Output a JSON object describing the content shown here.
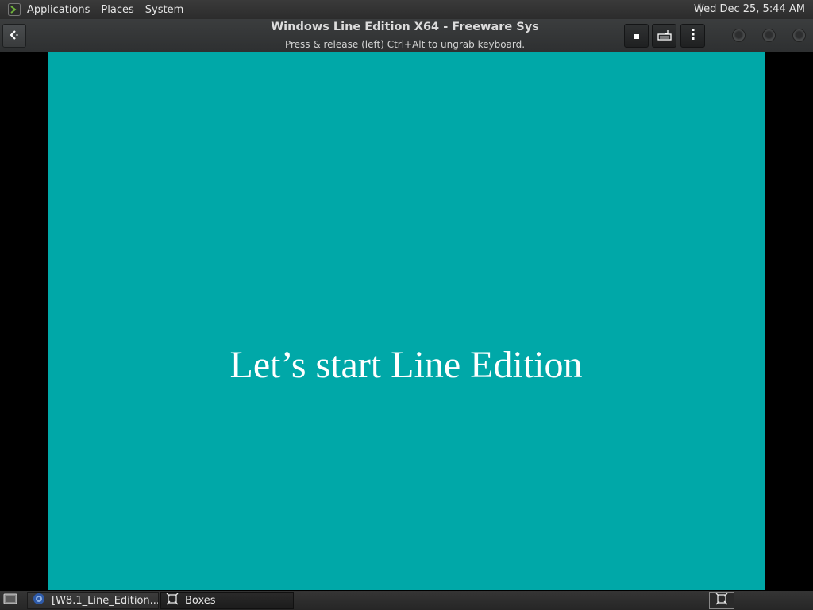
{
  "top_panel": {
    "logo_icon": "terminal-logo-icon",
    "menus": [
      "Applications",
      "Places",
      "System"
    ],
    "clock": "Wed Dec 25,  5:44 AM"
  },
  "header": {
    "back_icon": "back-arrow-icon",
    "title": "Windows Line Edition X64 - Freeware Sys",
    "subtitle": "Press & release (left) Ctrl+Alt to ungrab keyboard.",
    "buttons": [
      {
        "icon": "stop-icon"
      },
      {
        "icon": "keyboard-send-icon"
      },
      {
        "icon": "more-options-icon"
      }
    ],
    "window_controls": [
      "minimize",
      "maximize",
      "close"
    ]
  },
  "vm": {
    "background_color": "#00a8a8",
    "message": "Let’s start Line Edition"
  },
  "taskbar": {
    "items": [
      {
        "label": "[W8.1_Line_Edition...",
        "icon": "firefox-icon",
        "active": false
      },
      {
        "label": "Boxes",
        "icon": "boxes-icon",
        "active": true
      }
    ]
  }
}
